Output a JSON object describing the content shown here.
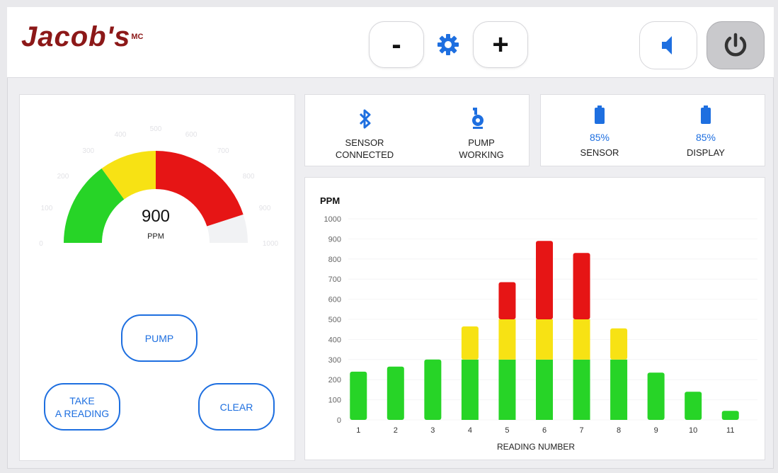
{
  "brand": {
    "name": "Jacob's",
    "sup": "MC"
  },
  "header": {
    "minus_label": "-",
    "plus_label": "+",
    "icons": [
      "gear-icon",
      "speaker-icon",
      "power-icon"
    ]
  },
  "gauge": {
    "value": "900",
    "unit": "PPM",
    "max": 1000,
    "reading": 900,
    "zones": [
      {
        "from": 0,
        "to": 300,
        "color": "#27d427"
      },
      {
        "from": 300,
        "to": 500,
        "color": "#f7e214"
      },
      {
        "from": 500,
        "to": 900,
        "color": "#e61515"
      }
    ],
    "scale_labels": [
      "0",
      "100",
      "200",
      "300",
      "400",
      "500",
      "600",
      "700",
      "800",
      "900",
      "1000"
    ]
  },
  "buttons": {
    "pump": "PUMP",
    "take_reading": "TAKE\nA READING",
    "clear": "CLEAR"
  },
  "status": {
    "sensor": {
      "line1": "SENSOR",
      "line2": "CONNECTED",
      "icon": "bluetooth-icon"
    },
    "pump": {
      "line1": "PUMP",
      "line2": "WORKING",
      "icon": "pump-icon"
    }
  },
  "battery": {
    "sensor": {
      "pct": "85%",
      "label": "SENSOR",
      "icon": "battery-icon"
    },
    "display": {
      "pct": "85%",
      "label": "DISPLAY",
      "icon": "battery-icon"
    }
  },
  "colors": {
    "accent": "#1e6fe0",
    "brand": "#8c1818",
    "green": "#27d427",
    "yellow": "#f7e214",
    "red": "#e61515"
  },
  "chart_data": {
    "type": "bar",
    "ylabel": "PPM",
    "xlabel": "READING NUMBER",
    "ylim": [
      0,
      1000
    ],
    "yticks": [
      0,
      100,
      200,
      300,
      400,
      500,
      600,
      700,
      800,
      900,
      1000
    ],
    "categories": [
      "1",
      "2",
      "3",
      "4",
      "5",
      "6",
      "7",
      "8",
      "9",
      "10",
      "11"
    ],
    "values": [
      240,
      265,
      300,
      465,
      685,
      890,
      830,
      455,
      235,
      140,
      45
    ],
    "thresholds": [
      {
        "upto": 300,
        "color": "#27d427"
      },
      {
        "upto": 500,
        "color": "#f7e214"
      },
      {
        "upto": 1000,
        "color": "#e61515"
      }
    ]
  }
}
